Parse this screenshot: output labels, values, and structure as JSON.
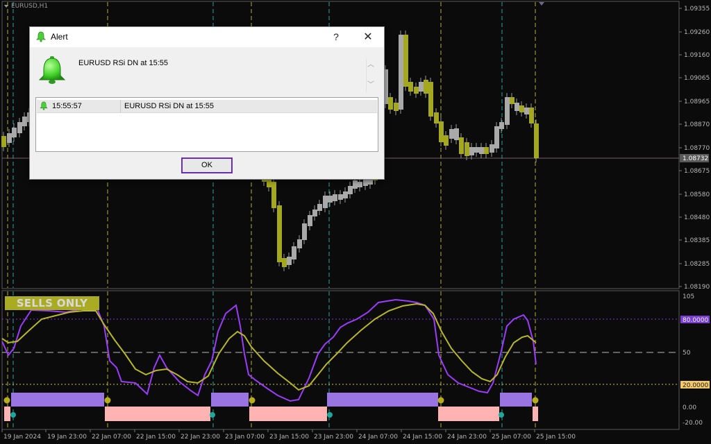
{
  "chart": {
    "symbol": "EURUSD,H1",
    "current_price": "1.08732",
    "price_ticks": [
      "1.09355",
      "1.09260",
      "1.09160",
      "1.09065",
      "1.08965",
      "1.08870",
      "1.08770",
      "1.08675",
      "1.08580",
      "1.08480",
      "1.08385",
      "1.08285",
      "1.08190"
    ],
    "time_labels": [
      "19 Jan 2024",
      "19 Jan 23:00",
      "22 Jan 07:00",
      "22 Jan 15:00",
      "22 Jan 23:00",
      "23 Jan 07:00",
      "23 Jan 15:00",
      "23 Jan 23:00",
      "24 Jan 07:00",
      "24 Jan 15:00",
      "24 Jan 23:00",
      "25 Jan 07:00",
      "25 Jan 15:00"
    ],
    "colors": {
      "bull": "#a9a9a9",
      "bear": "#a3a81e",
      "rsi": "#9c3cff",
      "signal": "#b8b62a",
      "up_band": "#9a74e0",
      "dn_band": "#ffb3b3"
    }
  },
  "indicator": {
    "badge": "SELLS ONLY",
    "levels": [
      "105",
      "80.0000",
      "50",
      "20.0000",
      "0.00",
      "-20.00"
    ]
  },
  "dialog": {
    "title": "Alert",
    "help": "?",
    "close": "✕",
    "message": "EURUSD RSi DN at 15:55",
    "list": [
      {
        "time": "15:55:57",
        "text": "EURUSD RSi DN at 15:55"
      }
    ],
    "ok_label": "OK"
  },
  "chart_data": {
    "type": "candlestick",
    "symbol": "EURUSD",
    "timeframe": "H1",
    "x": [
      "19 Jan 2024",
      "19 Jan 23:00",
      "22 Jan 07:00",
      "22 Jan 15:00",
      "22 Jan 23:00",
      "23 Jan 07:00",
      "23 Jan 15:00",
      "23 Jan 23:00",
      "24 Jan 07:00",
      "24 Jan 15:00",
      "24 Jan 23:00",
      "25 Jan 07:00",
      "25 Jan 15:00"
    ],
    "close": [
      1.0892,
      1.0905,
      1.089,
      1.088,
      1.0885,
      1.086,
      1.083,
      1.0863,
      1.087,
      1.09,
      1.0878,
      1.089,
      1.08732
    ],
    "ylim": [
      1.0817,
      1.0941
    ],
    "indicator": {
      "type": "line",
      "series": [
        {
          "name": "RSI",
          "values": [
            55,
            98,
            30,
            35,
            30,
            95,
            20,
            50,
            80,
            100,
            18,
            85,
            35
          ]
        },
        {
          "name": "Signal",
          "values": [
            60,
            90,
            45,
            30,
            35,
            75,
            22,
            40,
            70,
            95,
            30,
            55,
            60
          ]
        }
      ],
      "levels": [
        80,
        50,
        20
      ],
      "ylim": [
        -20,
        105
      ]
    }
  }
}
